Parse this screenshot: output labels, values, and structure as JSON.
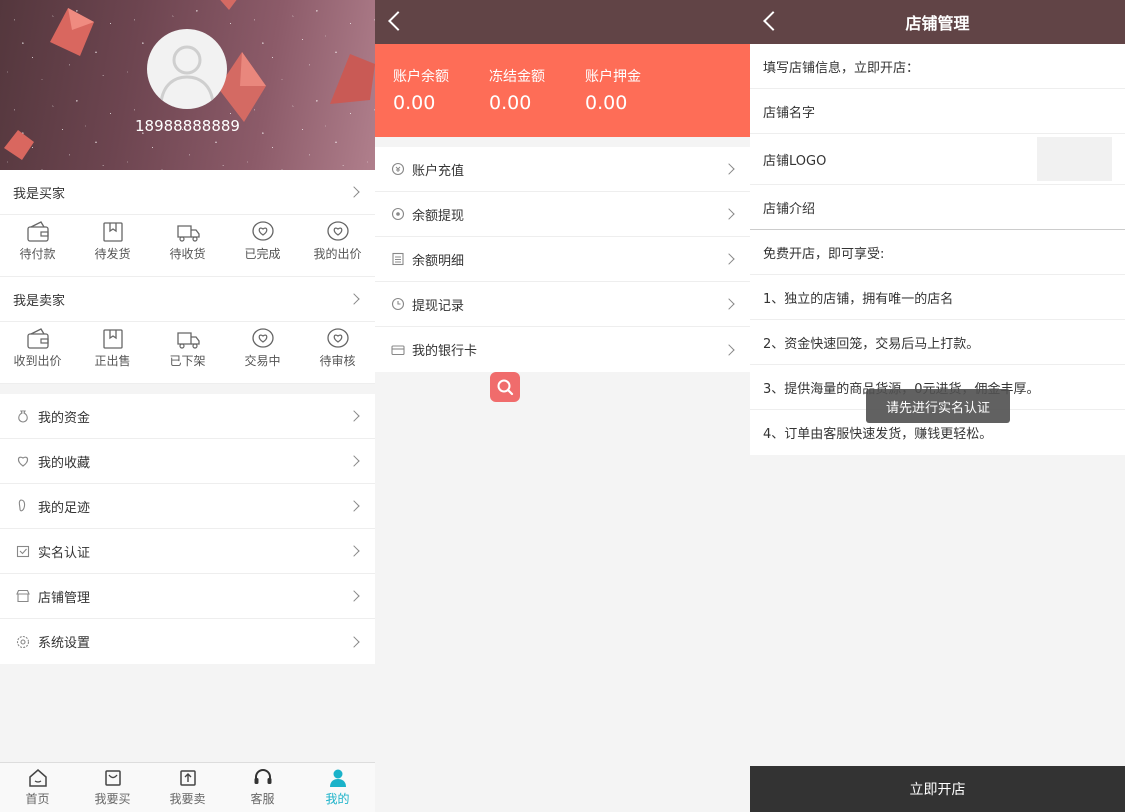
{
  "profile": {
    "phone": "18988888889",
    "buyer": {
      "title": "我是买家",
      "items": [
        "待付款",
        "待发货",
        "待收货",
        "已完成",
        "我的出价"
      ]
    },
    "seller": {
      "title": "我是卖家",
      "items": [
        "收到出价",
        "正出售",
        "已下架",
        "交易中",
        "待审核"
      ]
    },
    "menu": [
      {
        "label": "我的资金",
        "icon": "money-bag-icon"
      },
      {
        "label": "我的收藏",
        "icon": "heart-icon"
      },
      {
        "label": "我的足迹",
        "icon": "footprint-icon"
      },
      {
        "label": "实名认证",
        "icon": "verified-icon"
      },
      {
        "label": "店铺管理",
        "icon": "store-icon"
      },
      {
        "label": "系统设置",
        "icon": "gear-icon"
      }
    ],
    "tabbar": [
      {
        "label": "首页",
        "icon": "home-icon"
      },
      {
        "label": "我要买",
        "icon": "cart-icon"
      },
      {
        "label": "我要卖",
        "icon": "upload-icon"
      },
      {
        "label": "客服",
        "icon": "headset-icon"
      },
      {
        "label": "我的",
        "icon": "user-icon",
        "active": true
      }
    ]
  },
  "wallet": {
    "balances": [
      {
        "label": "账户余额",
        "value": "0.00"
      },
      {
        "label": "冻结金额",
        "value": "0.00"
      },
      {
        "label": "账户押金",
        "value": "0.00"
      }
    ],
    "menu": [
      {
        "label": "账户充值",
        "icon": "recharge-icon"
      },
      {
        "label": "余额提现",
        "icon": "withdraw-icon"
      },
      {
        "label": "余额明细",
        "icon": "list-icon"
      },
      {
        "label": "提现记录",
        "icon": "clock-icon"
      },
      {
        "label": "我的银行卡",
        "icon": "bank-card-icon"
      }
    ]
  },
  "shop": {
    "title": "店铺管理",
    "heading": "填写店铺信息，立即开店：",
    "name_label": "店铺名字",
    "logo_label": "店铺LOGO",
    "intro_label": "店铺介绍",
    "benefits_title": "免费开店，即可享受:",
    "benefits": [
      "1、独立的店铺，拥有唯一的店名",
      "2、资金快速回笼，交易后马上打款。",
      "3、提供海量的商品货源，0元进货，佣金丰厚。",
      "4、订单由客服快速发货，赚钱更轻松。"
    ],
    "toast": "请先进行实名认证",
    "open_button": "立即开店"
  },
  "colors": {
    "header_bg": "#614446",
    "balance_bg": "#fe6d57",
    "tab_active": "#1ab2c9",
    "open_button_bg": "#333333"
  }
}
